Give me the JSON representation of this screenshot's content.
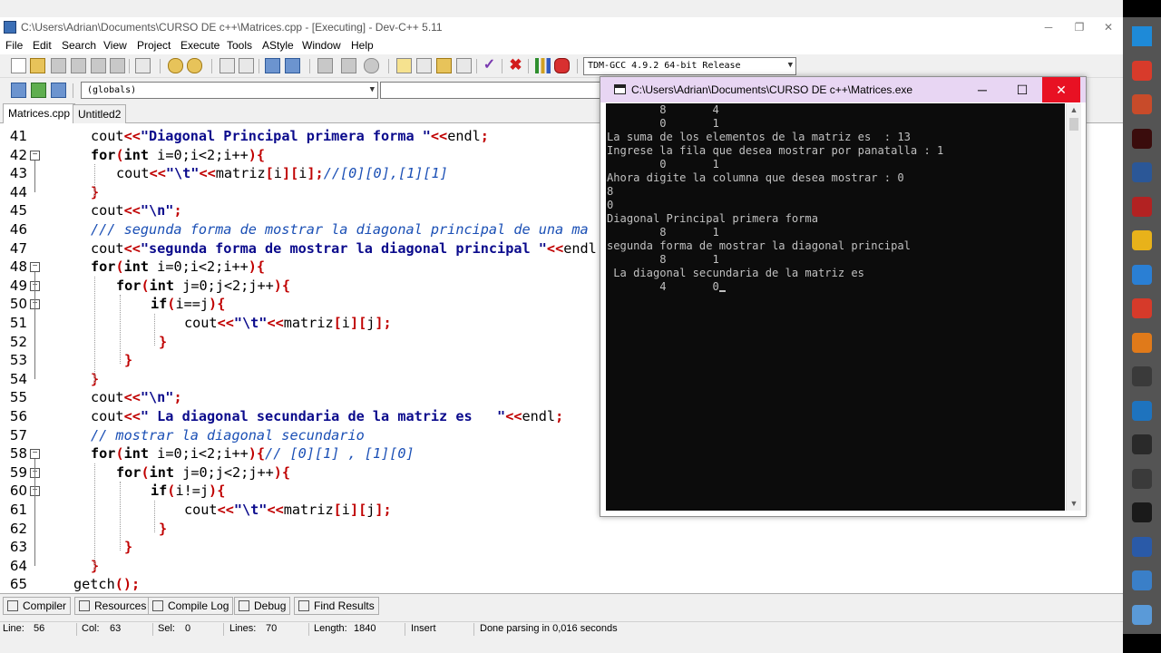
{
  "window": {
    "title": "C:\\Users\\Adrian\\Documents\\CURSO DE c++\\Matrices.cpp - [Executing] - Dev-C++ 5.11",
    "minimize": "─",
    "maximize": "❐",
    "close": "✕"
  },
  "menu": [
    "File",
    "Edit",
    "Search",
    "View",
    "Project",
    "Execute",
    "Tools",
    "AStyle",
    "Window",
    "Help"
  ],
  "toolbar": {
    "compiler": "TDM-GCC 4.9.2 64-bit Release",
    "scope": "(globals)"
  },
  "tabs": [
    "Matrices.cpp",
    "Untitled2"
  ],
  "editor": {
    "line_numbers": [
      "41",
      "42",
      "43",
      "44",
      "45",
      "46",
      "47",
      "48",
      "49",
      "50",
      "51",
      "52",
      "53",
      "54",
      "55",
      "56",
      "57",
      "58",
      "59",
      "60",
      "61",
      "62",
      "63",
      "64",
      "65"
    ],
    "lines": {
      "l41": [
        "cout",
        "<<",
        "\"Diagonal Principal primera forma \"",
        "<<",
        "endl",
        ";"
      ],
      "l42": [
        "for",
        "(",
        "int",
        " i=0;i<2;i++",
        ")",
        "{"
      ],
      "l43": [
        "cout",
        "<<",
        "\"\\t\"",
        "<<",
        "matriz",
        "[",
        "i",
        "][",
        "i",
        "];",
        "//[0][0],[1][1]"
      ],
      "l44": [
        "}"
      ],
      "l45": [
        "cout",
        "<<",
        "\"\\n\"",
        ";"
      ],
      "l46": [
        "/// segunda forma de mostrar la diagonal principal de una ma"
      ],
      "l47": [
        "cout",
        "<<",
        "\"segunda forma de mostrar la diagonal principal \"",
        "<<",
        "endl"
      ],
      "l48": [
        "for",
        "(",
        "int",
        " i=0;i<2;i++",
        ")",
        "{"
      ],
      "l49": [
        "for",
        "(",
        "int",
        " j=0;j<2;j++",
        ")",
        "{"
      ],
      "l50": [
        "if",
        "(",
        "i==j",
        ")",
        "{"
      ],
      "l51": [
        "cout",
        "<<",
        "\"\\t\"",
        "<<",
        "matriz",
        "[",
        "i",
        "][",
        "j",
        "];"
      ],
      "l52": [
        "}"
      ],
      "l53": [
        "}"
      ],
      "l54": [
        "}"
      ],
      "l55": [
        "cout",
        "<<",
        "\"\\n\"",
        ";"
      ],
      "l56": [
        "cout",
        "<<",
        "\" La diagonal secundaria de la matriz es   \"",
        "<<",
        "endl",
        ";"
      ],
      "l57": [
        "// mostrar la diagonal secundario"
      ],
      "l58": [
        "for",
        "(",
        "int",
        " i=0;i<2;i++",
        ")",
        "{",
        "// [0][1] , [1][0]"
      ],
      "l59": [
        "for",
        "(",
        "int",
        " j=0;j<2;j++",
        ")",
        "{"
      ],
      "l60": [
        "if",
        "(",
        "i!=j",
        ")",
        "{"
      ],
      "l61": [
        "cout",
        "<<",
        "\"\\t\"",
        "<<",
        "matriz",
        "[",
        "i",
        "][",
        "j",
        "];"
      ],
      "l62": [
        "}"
      ],
      "l63": [
        "}"
      ],
      "l64": [
        "}"
      ],
      "l65": [
        "getch",
        "();"
      ]
    }
  },
  "bottom_tabs": [
    "Compiler",
    "Resources",
    "Compile Log",
    "Debug",
    "Find Results"
  ],
  "status": {
    "line_label": "Line:",
    "line": "56",
    "col_label": "Col:",
    "col": "63",
    "sel_label": "Sel:",
    "sel": "0",
    "lines_label": "Lines:",
    "lines": "70",
    "length_label": "Length:",
    "length": "1840",
    "mode": "Insert",
    "message": "Done parsing in 0,016 seconds"
  },
  "console": {
    "title": "C:\\Users\\Adrian\\Documents\\CURSO DE c++\\Matrices.exe",
    "minimize": "─",
    "maximize": "☐",
    "close": "✕",
    "output": [
      "        8       4",
      "        0       1",
      "La suma de los elementos de la matriz es  : 13",
      "Ingrese la fila que desea mostrar por panatalla : 1",
      "        0       1",
      "Ahora digite la columna que desea mostrar : 0",
      "8",
      "0",
      "Diagonal Principal primera forma",
      "        8       1",
      "segunda forma de mostrar la diagonal principal",
      "        8       1",
      " La diagonal secundaria de la matriz es",
      "        4       0"
    ]
  },
  "colors": {
    "keyword": "#000000",
    "string": "#0a0a8c",
    "operator": "#c00000",
    "comment": "#1a4fb5",
    "console_bg": "#0c0c0c",
    "console_title_bg": "#e8d6f3",
    "close_red": "#e81123"
  },
  "taskbar_icons": [
    "windows-icon",
    "chrome-alt-icon",
    "paint-icon",
    "animate-icon",
    "word-icon",
    "typing-icon",
    "chrome-icon",
    "firefox-icon",
    "star-icon",
    "java-icon",
    "sublime-icon",
    "blue-app-icon",
    "steam-icon",
    "help-icon",
    "camera-icon",
    "devcpp-icon",
    "box-icon",
    "pen-icon"
  ]
}
